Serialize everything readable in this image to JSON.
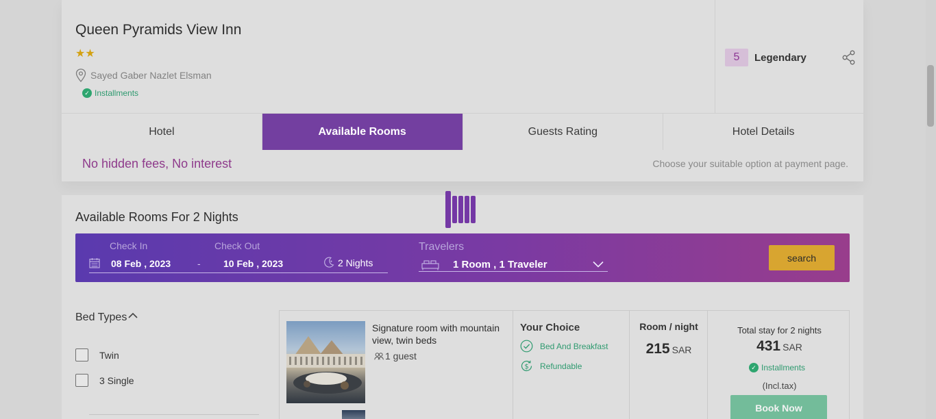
{
  "hotel": {
    "name": "Queen Pyramids View Inn",
    "stars": "★★",
    "address": "Sayed Gaber Nazlet Elsman",
    "installments": "Installments",
    "rating_score": "5",
    "rating_label": "Legendary"
  },
  "tabs": [
    {
      "label": "Hotel"
    },
    {
      "label": "Available Rooms"
    },
    {
      "label": "Guests Rating"
    },
    {
      "label": "Hotel Details"
    }
  ],
  "fees": {
    "title": "No hidden fees, No interest",
    "note": "Choose your suitable option at payment page."
  },
  "rooms": {
    "title": "Available Rooms For 2 Nights"
  },
  "search": {
    "check_in_label": "Check In",
    "check_in_value": "08 Feb , 2023",
    "separator": "-",
    "check_out_label": "Check Out",
    "check_out_value": "10 Feb , 2023",
    "nights": "2 Nights",
    "travelers_label": "Travelers",
    "travelers_value": "1 Room , 1 Traveler",
    "button": "search"
  },
  "filters": {
    "bed_types_label": "Bed Types",
    "options": [
      {
        "label": "Twin"
      },
      {
        "label": "3 Single"
      }
    ]
  },
  "room": {
    "name": "Signature room with mountain view, twin beds",
    "guests": "1 guest",
    "choice_title": "Your Choice",
    "choice_items": [
      "Bed And Breakfast",
      "Refundable"
    ],
    "night_title": "Room / night",
    "night_price": "215",
    "night_currency": "SAR",
    "total_label": "Total stay for 2 nights",
    "total_price": "431",
    "total_currency": "SAR",
    "total_installments": "Installments",
    "incl_tax": "(Incl.tax)",
    "book_button": "Book Now"
  },
  "colors": {
    "accent_purple": "#733fa0",
    "fees_magenta": "#8e3a8b",
    "success_green": "#2e9a6f",
    "search_gold": "#d8a530",
    "book_green": "#73bc9a"
  },
  "icons": [
    "pin-icon",
    "check-circle-icon",
    "share-icon",
    "calendar-icon",
    "moon-icon",
    "bed-icon",
    "chevron-down-icon",
    "chevron-up-icon",
    "guests-icon",
    "check-outline-icon",
    "refund-icon",
    "loader-icon"
  ]
}
